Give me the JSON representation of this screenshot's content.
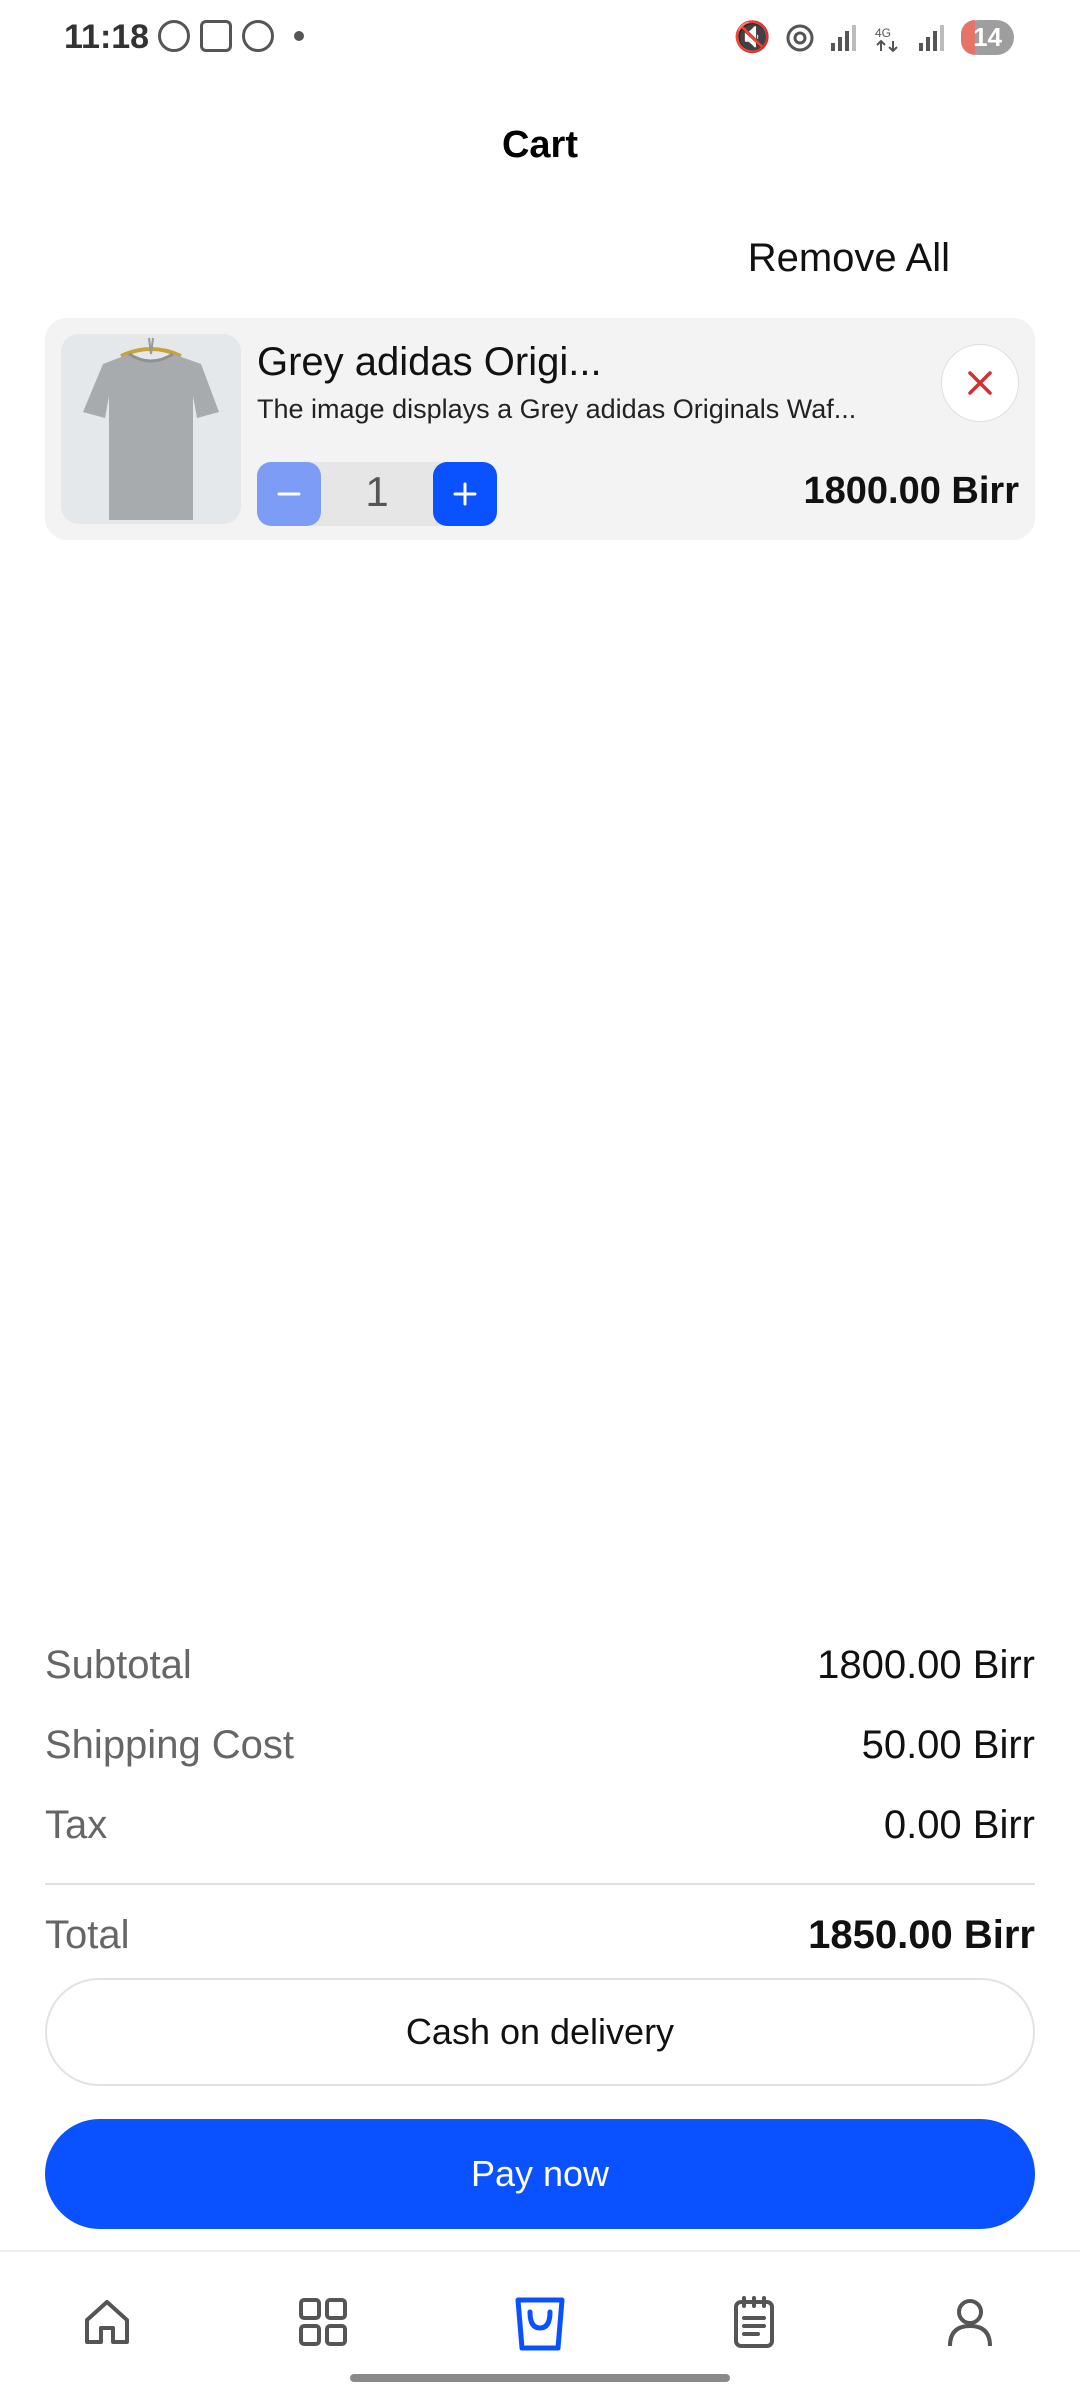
{
  "status_bar": {
    "time": "11:18",
    "battery": "14",
    "left_icons": [
      "add-circle-icon",
      "screenshot-icon",
      "add-circle-icon",
      "dot-icon"
    ],
    "right_icons": [
      "mute-icon",
      "hotspot-icon",
      "signal-icon",
      "4g-icon",
      "signal-icon",
      "battery-icon"
    ]
  },
  "header": {
    "title": "Cart",
    "remove_all_label": "Remove All"
  },
  "cart_items": [
    {
      "name": "Grey adidas Origi...",
      "description": "The image displays a Grey adidas Originals Waf...",
      "quantity": "1",
      "price": "1800.00 Birr",
      "image_icon": "tshirt-image"
    }
  ],
  "summary": {
    "subtotal_label": "Subtotal",
    "subtotal_value": "1800.00 Birr",
    "shipping_label": "Shipping Cost",
    "shipping_value": "50.00 Birr",
    "tax_label": "Tax",
    "tax_value": "0.00 Birr",
    "total_label": "Total",
    "total_value": "1850.00 Birr"
  },
  "actions": {
    "cod_label": "Cash on delivery",
    "pay_label": "Pay now"
  },
  "nav": {
    "items": [
      "home-icon",
      "grid-icon",
      "bag-icon",
      "orders-icon",
      "profile-icon"
    ],
    "active": "bag-icon"
  },
  "colors": {
    "primary": "#0a52ff",
    "primary_light": "#7d9cf6",
    "delete_red": "#d32f2f",
    "card_bg": "#f3f3f3"
  }
}
